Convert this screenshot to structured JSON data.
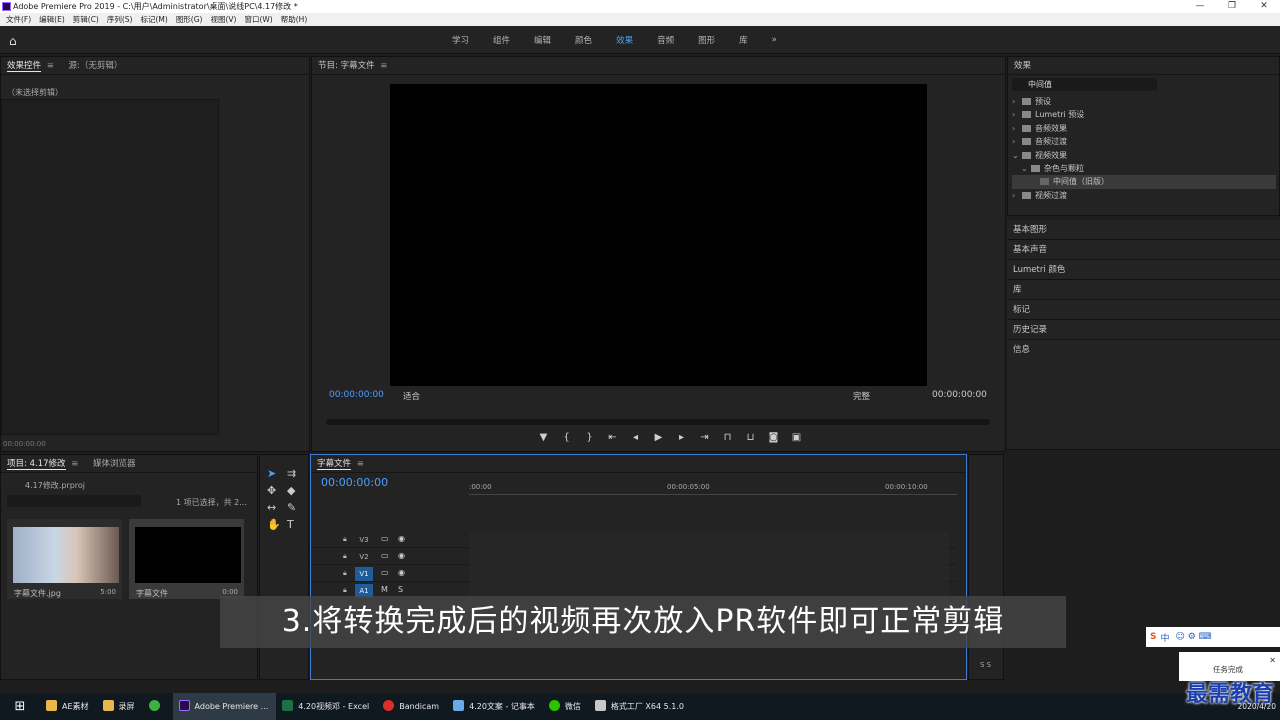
{
  "window": {
    "title": "Adobe Premiere Pro 2019 - C:\\用户\\Administrator\\桌面\\说线PC\\4.17修改 *"
  },
  "menu": [
    "文件(F)",
    "编辑(E)",
    "剪辑(C)",
    "序列(S)",
    "标记(M)",
    "图形(G)",
    "视图(V)",
    "窗口(W)",
    "帮助(H)"
  ],
  "workspaces": {
    "items": [
      "学习",
      "组件",
      "编辑",
      "颜色",
      "效果",
      "音频",
      "图形",
      "库"
    ],
    "active": "效果",
    "overflow": "»"
  },
  "effect_controls": {
    "tab": "效果控件",
    "source_tab": "源:（无剪辑）",
    "no_clip": "（未选择剪辑）",
    "timecode": "00:00:00:00"
  },
  "program": {
    "title": "节目: 字幕文件",
    "timecode_left": "00:00:00:00",
    "fit": "适合",
    "quality": "完整",
    "timecode_right": "00:00:00:00"
  },
  "effects": {
    "title": "效果",
    "search_value": "中间值",
    "tree": [
      {
        "label": "预设",
        "depth": 0,
        "expanded": false
      },
      {
        "label": "Lumetri 预设",
        "depth": 0,
        "expanded": false
      },
      {
        "label": "音频效果",
        "depth": 0,
        "expanded": false
      },
      {
        "label": "音频过渡",
        "depth": 0,
        "expanded": false
      },
      {
        "label": "视频效果",
        "depth": 0,
        "expanded": true
      },
      {
        "label": "杂色与颗粒",
        "depth": 1,
        "expanded": true
      },
      {
        "label": "中间值（旧版）",
        "depth": 2,
        "selected": true
      },
      {
        "label": "视频过渡",
        "depth": 0,
        "expanded": false
      }
    ]
  },
  "side_panels": [
    "基本图形",
    "基本声音",
    "Lumetri 颜色",
    "库",
    "标记",
    "历史记录",
    "信息"
  ],
  "project": {
    "tab": "项目: 4.17修改",
    "tab2": "媒体浏览器",
    "file": "4.17修改.prproj",
    "selection": "1 项已选择，共 2...",
    "items": [
      {
        "name": "字幕文件.jpg",
        "duration": "5:00"
      },
      {
        "name": "字幕文件",
        "duration": "0:00"
      }
    ]
  },
  "timeline": {
    "title": "字幕文件",
    "timecode": "00:00:00:00",
    "ruler": [
      ":00:00",
      "00:00:05:00",
      "00:00:10:00"
    ],
    "tracks": [
      {
        "label": "V3",
        "targeted": false
      },
      {
        "label": "V2",
        "targeted": false
      },
      {
        "label": "V1",
        "targeted": true
      },
      {
        "label": "A1",
        "targeted": true
      }
    ],
    "meter_label": "S S"
  },
  "caption": "3.将转换完成后的视频再次放入PR软件即可正常剪辑",
  "taskbar": {
    "items": [
      {
        "label": "AE素材",
        "color": "#e8b84a"
      },
      {
        "label": "录屏",
        "color": "#e8b84a"
      },
      {
        "label": "",
        "color": "#3cb043"
      },
      {
        "label": "Adobe Premiere ...",
        "color": "#9b6bff",
        "active": true
      },
      {
        "label": "4.20视频邓 - Excel",
        "color": "#1d7044"
      },
      {
        "label": "Bandicam",
        "color": "#d9302c"
      },
      {
        "label": "4.20文案 - 记事本",
        "color": "#6aa9e8"
      },
      {
        "label": "微信",
        "color": "#2dc100"
      },
      {
        "label": "格式工厂 X64 5.1.0",
        "color": "#c8c8c8"
      }
    ],
    "clock_date": "2020/4/20",
    "ime": "中"
  },
  "notification": {
    "text": "任务完成"
  },
  "watermark": "最需教育"
}
